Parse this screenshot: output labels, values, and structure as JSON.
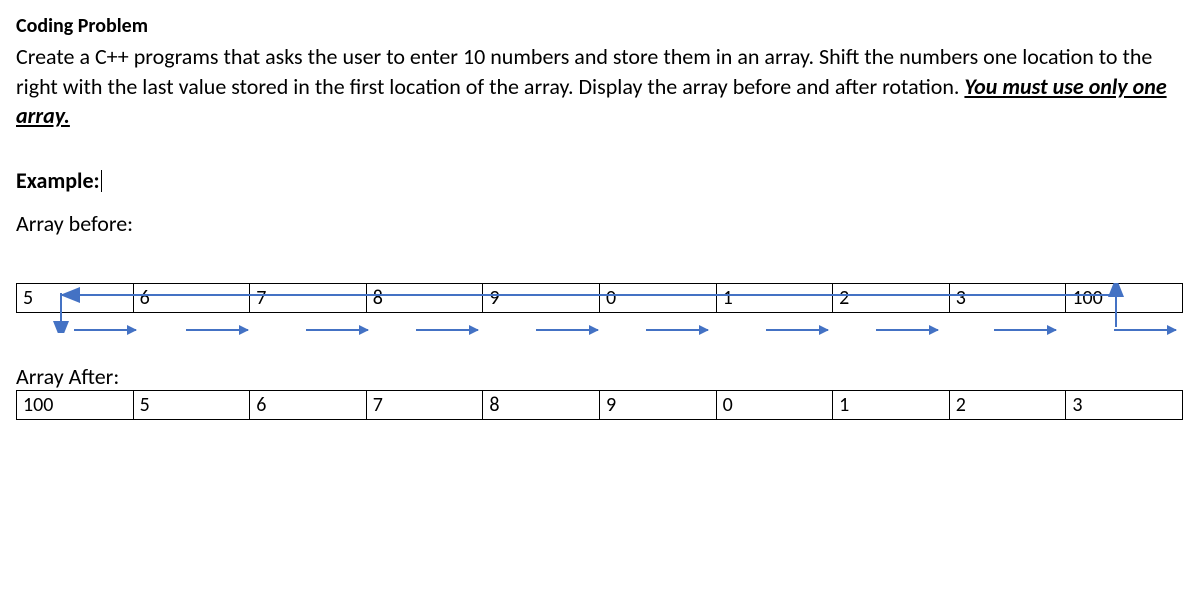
{
  "title": "Coding Problem",
  "description_pre": "Create a C++ programs that asks the user to enter 10 numbers and store them in an array. Shift the numbers one location to the right with the last value stored in the first location of the array. Display the array before and after rotation. ",
  "description_emph": "You must use only one array.",
  "example_label": "Example:",
  "before_label": "Array before:",
  "after_label": "Array After:",
  "array_before": [
    "5",
    "6",
    "7",
    "8",
    "9",
    "0",
    "1",
    "2",
    "3",
    "100"
  ],
  "array_after": [
    "100",
    "5",
    "6",
    "7",
    "8",
    "9",
    "0",
    "1",
    "2",
    "3"
  ],
  "shift_arrow_lefts": [
    58,
    170,
    290,
    400,
    520,
    630,
    750,
    860,
    978,
    1098
  ]
}
